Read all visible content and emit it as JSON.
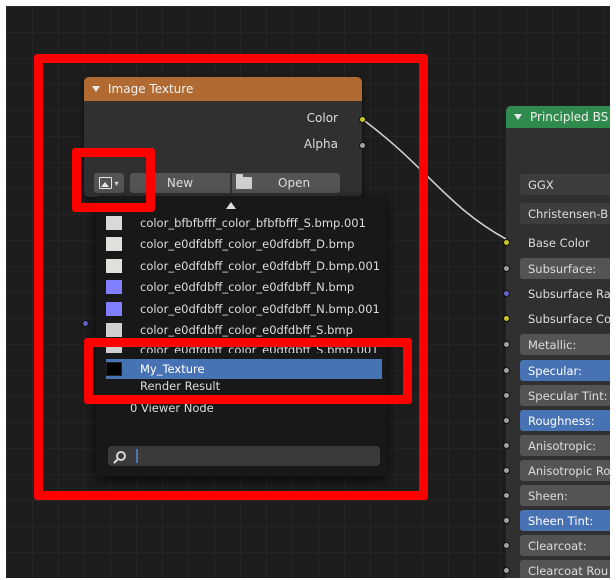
{
  "image_texture_node": {
    "title": "Image Texture",
    "outputs": [
      "Color",
      "Alpha"
    ],
    "new_label": "New",
    "open_label": "Open"
  },
  "dropdown": {
    "items": [
      {
        "label": "color_bfbfbfff_color_bfbfbfff_S.bmp.001",
        "swatch": "#d9d9d9"
      },
      {
        "label": "color_e0dfdbff_color_e0dfdbff_D.bmp",
        "swatch": "#e0dfdb"
      },
      {
        "label": "color_e0dfdbff_color_e0dfdbff_D.bmp.001",
        "swatch": "#e0dfdb"
      },
      {
        "label": "color_e0dfdbff_color_e0dfdbff_N.bmp",
        "swatch": "#7f7fff"
      },
      {
        "label": "color_e0dfdbff_color_e0dfdbff_N.bmp.001",
        "swatch": "#7f7fff"
      },
      {
        "label": "color_e0dfdbff_color_e0dfdbff_S.bmp",
        "swatch": "#d0d0d0"
      },
      {
        "label": "color_e0dfdbff_color_e0dfdbff_S.bmp.001",
        "swatch": "#d0d0d0"
      }
    ],
    "selected": {
      "label": "My_Texture",
      "swatch": "#000000"
    },
    "render_result": "Render Result",
    "viewer_node": "0 Viewer Node"
  },
  "principled_node": {
    "title": "Principled BS",
    "distribution": "GGX",
    "subsurface_method": "Christensen-B",
    "base_color": "Base Color",
    "rows": [
      {
        "label": "Subsurface:",
        "style": "gray"
      },
      {
        "label": "Subsurface Ra",
        "style": "plain"
      },
      {
        "label": "Subsurface Co",
        "style": "plain"
      },
      {
        "label": "Metallic:",
        "style": "gray"
      },
      {
        "label": "Specular:",
        "style": "blue"
      },
      {
        "label": "Specular Tint:",
        "style": "gray"
      },
      {
        "label": "Roughness:",
        "style": "blue"
      },
      {
        "label": "Anisotropic:",
        "style": "gray"
      },
      {
        "label": "Anisotropic Ro",
        "style": "gray"
      },
      {
        "label": "Sheen:",
        "style": "gray"
      },
      {
        "label": "Sheen Tint:",
        "style": "blue"
      },
      {
        "label": "Clearcoat:",
        "style": "gray"
      },
      {
        "label": "Clearcoat Rou",
        "style": "gray"
      }
    ]
  },
  "colors": {
    "highlight": "#ff0000",
    "selection": "#4772b3",
    "texture_header": "#b06a32",
    "shader_header": "#2f8a4e"
  }
}
